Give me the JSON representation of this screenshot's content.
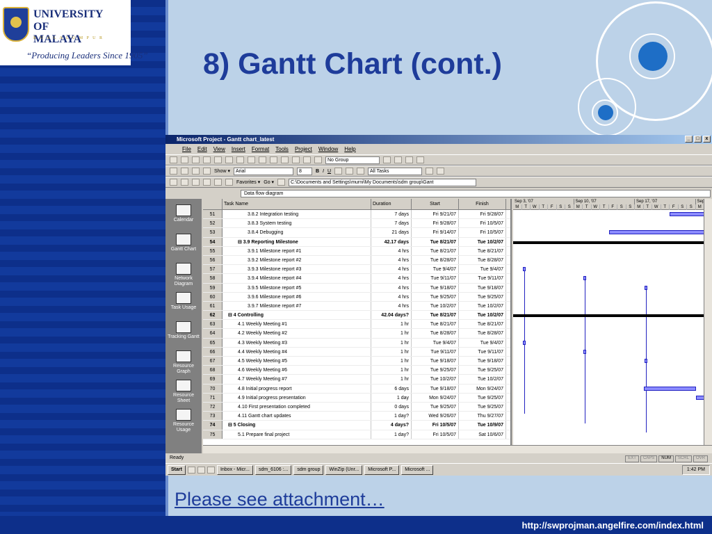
{
  "slide": {
    "title": "8) Gantt Chart (cont.)",
    "attachment_link": "Please see attachment…",
    "url": "http://swprojman.angelfire.com/index.html"
  },
  "logo": {
    "name": "UNIVERSITY OF MALAYA",
    "subtitle": "K U A L A   L U M P U R",
    "motto": "“Producing Leaders Since 1905”"
  },
  "app": {
    "title": "Microsoft Project - Gantt chart_latest",
    "menu": [
      "File",
      "Edit",
      "View",
      "Insert",
      "Format",
      "Tools",
      "Project",
      "Window",
      "Help"
    ],
    "group_select": "No Group",
    "show_label": "Show ▾",
    "font": "Arial",
    "font_size": "8",
    "filter": "All Tasks",
    "favorites": "Favorites ▾",
    "go": "Go ▾",
    "address": "C:\\Documents and Settings\\murni\\My Documents\\sdm group\\Gant",
    "entry": "Data flow diagram",
    "views": [
      "Calendar",
      "Gantt Chart",
      "Network Diagram",
      "Task Usage",
      "Tracking Gantt",
      "Resource Graph",
      "Resource Sheet",
      "Resource Usage"
    ],
    "columns": [
      "",
      "Task Name",
      "Duration",
      "Start",
      "Finish"
    ],
    "weeks": [
      "Sep 3, '07",
      "Sep 10, '07",
      "Sep 17, '07",
      "Sep"
    ],
    "days": [
      "M",
      "T",
      "W",
      "T",
      "F",
      "S",
      "S",
      "M",
      "T",
      "W",
      "T",
      "F",
      "S",
      "S",
      "M",
      "T",
      "W",
      "T",
      "F",
      "S",
      "S",
      "M"
    ],
    "tasks": [
      {
        "id": "51",
        "name": "3.8.2 Integration testing",
        "duration": "7 days",
        "start": "Fri 9/21/07",
        "finish": "Fri 9/28/07",
        "indent": 2,
        "bold": false
      },
      {
        "id": "52",
        "name": "3.8.3 System testing",
        "duration": "7 days",
        "start": "Fri 9/28/07",
        "finish": "Fri 10/5/07",
        "indent": 2,
        "bold": false
      },
      {
        "id": "53",
        "name": "3.8.4 Debugging",
        "duration": "21 days",
        "start": "Fri 9/14/07",
        "finish": "Fri 10/5/07",
        "indent": 2,
        "bold": false
      },
      {
        "id": "54",
        "name": "⊟ 3.9 Reporting Milestone",
        "duration": "42.17 days",
        "start": "Tue 8/21/07",
        "finish": "Tue 10/2/07",
        "indent": 1,
        "bold": true
      },
      {
        "id": "55",
        "name": "3.9.1 Milestone report #1",
        "duration": "4 hrs",
        "start": "Tue 8/21/07",
        "finish": "Tue 8/21/07",
        "indent": 2,
        "bold": false
      },
      {
        "id": "56",
        "name": "3.9.2 Milestone report #2",
        "duration": "4 hrs",
        "start": "Tue 8/28/07",
        "finish": "Tue 8/28/07",
        "indent": 2,
        "bold": false
      },
      {
        "id": "57",
        "name": "3.9.3 Milestone report #3",
        "duration": "4 hrs",
        "start": "Tue 9/4/07",
        "finish": "Tue 9/4/07",
        "indent": 2,
        "bold": false
      },
      {
        "id": "58",
        "name": "3.9.4 Milestone report #4",
        "duration": "4 hrs",
        "start": "Tue 9/11/07",
        "finish": "Tue 9/11/07",
        "indent": 2,
        "bold": false
      },
      {
        "id": "59",
        "name": "3.9.5 Milestone report #5",
        "duration": "4 hrs",
        "start": "Tue 9/18/07",
        "finish": "Tue 9/18/07",
        "indent": 2,
        "bold": false
      },
      {
        "id": "60",
        "name": "3.9.6 Milestone report #6",
        "duration": "4 hrs",
        "start": "Tue 9/25/07",
        "finish": "Tue 9/25/07",
        "indent": 2,
        "bold": false
      },
      {
        "id": "61",
        "name": "3.9.7 Milestone report #7",
        "duration": "4 hrs",
        "start": "Tue 10/2/07",
        "finish": "Tue 10/2/07",
        "indent": 2,
        "bold": false
      },
      {
        "id": "62",
        "name": "⊟ 4 Controlling",
        "duration": "42.04 days?",
        "start": "Tue 8/21/07",
        "finish": "Tue 10/2/07",
        "indent": 0,
        "bold": true
      },
      {
        "id": "63",
        "name": "4.1 Weekly Meeting #1",
        "duration": "1 hr",
        "start": "Tue 8/21/07",
        "finish": "Tue 8/21/07",
        "indent": 1,
        "bold": false
      },
      {
        "id": "64",
        "name": "4.2 Weekly Meeting #2",
        "duration": "1 hr",
        "start": "Tue 8/28/07",
        "finish": "Tue 8/28/07",
        "indent": 1,
        "bold": false
      },
      {
        "id": "65",
        "name": "4.3 Weekly Meeting #3",
        "duration": "1 hr",
        "start": "Tue 9/4/07",
        "finish": "Tue 9/4/07",
        "indent": 1,
        "bold": false
      },
      {
        "id": "66",
        "name": "4.4 Weekly Meeting #4",
        "duration": "1 hr",
        "start": "Tue 9/11/07",
        "finish": "Tue 9/11/07",
        "indent": 1,
        "bold": false
      },
      {
        "id": "67",
        "name": "4.5 Weekly Meeting #5",
        "duration": "1 hr",
        "start": "Tue 9/18/07",
        "finish": "Tue 9/18/07",
        "indent": 1,
        "bold": false
      },
      {
        "id": "68",
        "name": "4.6 Weekly Meeting #6",
        "duration": "1 hr",
        "start": "Tue 9/25/07",
        "finish": "Tue 9/25/07",
        "indent": 1,
        "bold": false
      },
      {
        "id": "69",
        "name": "4.7 Weekly Meeting #7",
        "duration": "1 hr",
        "start": "Tue 10/2/07",
        "finish": "Tue 10/2/07",
        "indent": 1,
        "bold": false
      },
      {
        "id": "70",
        "name": "4.8 Initial progress report",
        "duration": "6 days",
        "start": "Tue 9/18/07",
        "finish": "Mon 9/24/07",
        "indent": 1,
        "bold": false
      },
      {
        "id": "71",
        "name": "4.9 Initial progress presentation",
        "duration": "1 day",
        "start": "Mon 9/24/07",
        "finish": "Tue 9/25/07",
        "indent": 1,
        "bold": false
      },
      {
        "id": "72",
        "name": "4.10 First presentation completed",
        "duration": "0 days",
        "start": "Tue 9/25/07",
        "finish": "Tue 9/25/07",
        "indent": 1,
        "bold": false
      },
      {
        "id": "73",
        "name": "4.11 Gantt chart updates",
        "duration": "1 day?",
        "start": "Wed 9/26/07",
        "finish": "Thu 9/27/07",
        "indent": 1,
        "bold": false
      },
      {
        "id": "74",
        "name": "⊟ 5 Closing",
        "duration": "4 days?",
        "start": "Fri 10/5/07",
        "finish": "Tue 10/9/07",
        "indent": 0,
        "bold": true
      },
      {
        "id": "75",
        "name": "5.1 Prepare final project",
        "duration": "1 day?",
        "start": "Fri 10/5/07",
        "finish": "Sat 10/6/07",
        "indent": 1,
        "bold": false
      }
    ],
    "status": "Ready",
    "indicators": [
      {
        "label": "EXT",
        "on": false
      },
      {
        "label": "CAPS",
        "on": false
      },
      {
        "label": "NUM",
        "on": true
      },
      {
        "label": "SCRL",
        "on": false
      },
      {
        "label": "OVR",
        "on": false
      }
    ],
    "start_label": "Start",
    "taskbar": [
      "Inbox - Micr...",
      "sdm_6106 :...",
      "sdm group",
      "WinZip (Unr...",
      "Microsoft P...",
      "Microsoft ..."
    ],
    "clock": "1:42 PM"
  }
}
